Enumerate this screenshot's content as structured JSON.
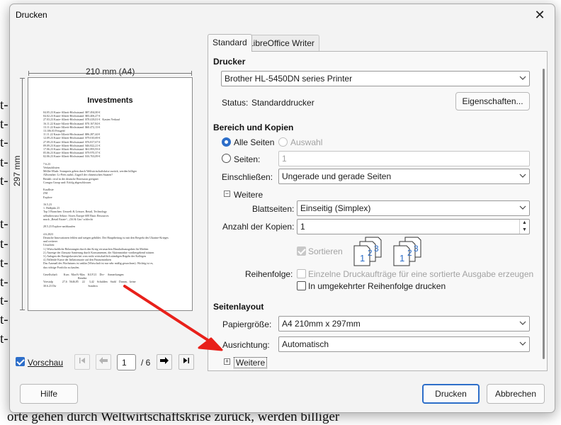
{
  "background": {
    "fragments": [
      "t-",
      "t-",
      "t-",
      "t-",
      "t-",
      "t-",
      "t-",
      "t-",
      "t-",
      "t-",
      "t-",
      "t-"
    ],
    "bottom_text": "orte gehen durch Weltwirtschaftskrise zurück, werden billiger"
  },
  "dialog": {
    "title": "Drucken",
    "close_icon": "close-icon"
  },
  "preview": {
    "paper_size": "210 mm (A4)",
    "paper_height": "297 mm",
    "page_title": "Investments",
    "page_lines": "04.05.23 Kaste-Allzeit-Höchststand  $87.494,00 €\n04.02.23 Kaste-Allzeit-Höchststand  $83.406,27 €\n27.03.23 Kaste-Allzeit-Höchststand  $78.418,01 €   Kasten Verkauf\n16.11.22 Kaste-Allzeit-Höchststand  $70.167,84 €\n13.11.22 Kaste-Allzeit-Höchststand  $60.472,13 €\n13.106.03 Festgeld\n11.11.22 Kaste-Allzeit-Höchststand  $86.287,44 €\n12.09.23 Kaste-Allzeit-Höchststand  $79.010,69 €\n27.09.23 Kaste-Allzeit-Höchststand  $76.817,67 €\n09.09.23 Kaste-Allzeit-Höchststand  $46.822,21 €\n17.06.23 Kaste-Allzeit-Höchststand  $61.893,93 €\n05.06.23 Kaste-Allzeit-Höchststand  $79.970,37 €\n02.06.23 Kaste-Allzeit-Höchststand  $16.763,09 €\n\n7.6.23\nVerkaufslisten\nMöller-Musk: Sonnpreis gehen durch Weltwirtschaftskrise zurück, werden billiger\nAllweather: Li-Preis stabil, Zugriff der chinesischen Staaten?\nBeulah: rival in der deutsche Rezession geeignet\nComgra Group und: Erfolg abgeschlossen\n\nKaufliste\nZM\nExplore\n\n16.5.23\n1. Halbjahr 23\nTop 3 Branchen: Umwelt & Leisure, Retail, Technology\nselbstbewusst Sektor: Sixers Europe 600 Basic Resources\nmuck „Retail Estate“, „Oil & Gas“ schlecht\n\n28.5.23 Explore nachkaufen\n\n4.6.2023\nDeutsche Innovationen fehlen und steigen gebildet. Der Hauptbeitrag ist mit den Respekt des Ukraine-Krieges\nund weiterer\nUrsachen:\n1.) Wirtschaftliche Belastungen durch den Krieg verursachen Haushaltsausgaben für Medien\n2.) Anzeige der Zinssatz Sanierung durch Konsumenten, die Aktienmärkte vorübergehend stützen\n3.) Anlagen der Energiekosten bei vom nicht wirtschaftlich ständigen Regeln der Kollegen\n4.) Fallende Kurse der Inflationsrate auf den Finanzmärkten\nDas Ausmaß des Wachstums ist unklar (Wirtschaft ist nur sehr mäßig gewachsen). Wichtig ist es,\ndas richtige Portfolio zu kaufen.\n\nGesellschaft         Kurs   Max%-Max    KGV21    Div-    Anmerkungen\n                                                 Rendite\nVoestalp             27,6   5646,85     22      3,42    Schulden    Stahl    Dumm,   keine\n30.6.23 Dir                                             Sondern"
  },
  "preview_toolbar": {
    "checkbox_label": "Vorschau",
    "checked": true,
    "current_page": "1",
    "page_total": "/ 6"
  },
  "tabs": [
    {
      "label": "Standard",
      "active": true
    },
    {
      "label": "LibreOffice Writer",
      "active": false
    }
  ],
  "printer": {
    "heading": "Drucker",
    "selected": "Brother HL-5450DN series Printer",
    "status_label": "Status:",
    "status_value": "Standarddrucker",
    "properties_button": "Eigenschaften..."
  },
  "range": {
    "heading": "Bereich und Kopien",
    "all_pages": "Alle Seiten",
    "selection": "Auswahl",
    "pages_label": "Seiten:",
    "pages_value": "1",
    "include_label": "Einschließen:",
    "include_value": "Ungerade und gerade Seiten",
    "more_label": "Weitere",
    "sides_label": "Blattseiten:",
    "sides_value": "Einseitig (Simplex)",
    "copies_label": "Anzahl der Kopien:",
    "copies_value": "1",
    "collate_label": "Sortieren",
    "order_label": "Reihenfolge:",
    "order_option1": "Einzelne Druckaufträge für eine sortierte Ausgabe erzeugen",
    "order_option2": "In umgekehrter Reihenfolge drucken"
  },
  "layout": {
    "heading": "Seitenlayout",
    "paper_label": "Papiergröße:",
    "paper_value": "A4 210mm x 297mm",
    "orientation_label": "Ausrichtung:",
    "orientation_value": "Automatisch",
    "more_label": "Weitere"
  },
  "footer": {
    "help": "Hilfe",
    "print": "Drucken",
    "cancel": "Abbrechen"
  },
  "colors": {
    "accent": "#2d6ec9",
    "annotation_arrow": "#e8201a"
  }
}
